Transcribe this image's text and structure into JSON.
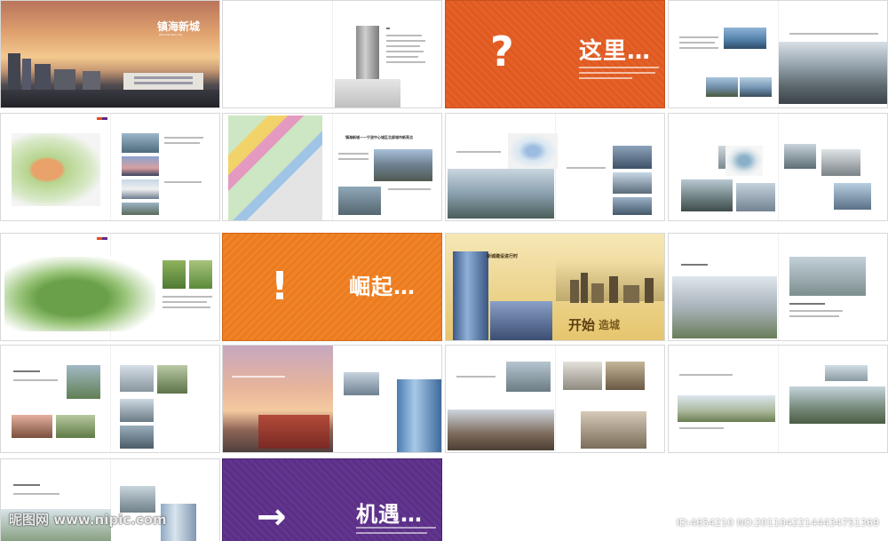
{
  "cover": {
    "title": "镇海新城",
    "subtitle": "Zhenhai New City"
  },
  "plates": {
    "question": {
      "glyph": "?",
      "title": "这里…"
    },
    "exclaim": {
      "glyph": "!",
      "title": "崛起…"
    },
    "arrow": {
      "glyph": "→",
      "title": "机遇…"
    }
  },
  "start": {
    "title_a": "开始",
    "title_b": "造城",
    "heading": "新城建设进行时"
  },
  "map_page": {
    "heading": "镇海新城——宁波中心城区北部城市新亮点"
  },
  "watermark": {
    "site": "昵图网 www.nipic.com",
    "id": "ID:4654210 NO:20110422144434751369"
  },
  "colors": {
    "orange": "#e05a20",
    "orange_light": "#ec7a1f",
    "purple": "#5b2f86",
    "gold": "#e8c46a"
  }
}
